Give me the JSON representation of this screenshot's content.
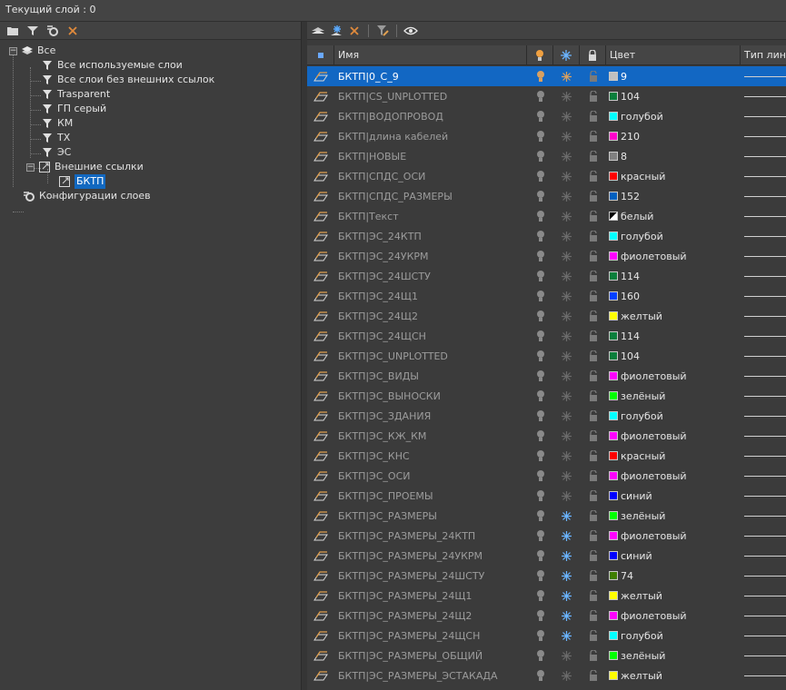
{
  "header": {
    "current_layer": "Текущий слой : 0"
  },
  "filters": {
    "root": "Все",
    "items": [
      "Все используемые слои",
      "Все слои без внешних ссылок",
      "Trasparent",
      "ГП серый",
      "КМ",
      "ТХ",
      "ЭС"
    ],
    "xref_group": "Внешние ссылки",
    "xref_item": "БКТП",
    "config": "Конфигурации слоев"
  },
  "columns": {
    "name": "Имя",
    "color": "Цвет",
    "linetype": "Тип лин"
  },
  "layers": [
    {
      "name": "БКТП|0_С_9",
      "color_name": "9",
      "color": "#c0c0c0",
      "frozen": false,
      "selected": true
    },
    {
      "name": "БКТП|CS_UNPLOTTED",
      "color_name": "104",
      "color": "#0a7f3c",
      "frozen": false
    },
    {
      "name": "БКТП|ВОДОПРОВОД",
      "color_name": "голубой",
      "color": "#00ffff",
      "frozen": false
    },
    {
      "name": "БКТП|длина кабелей",
      "color_name": "210",
      "color": "#ff00cc",
      "frozen": false
    },
    {
      "name": "БКТП|НОВЫЕ",
      "color_name": "8",
      "color": "#808080",
      "frozen": false
    },
    {
      "name": "БКТП|СПДС_ОСИ",
      "color_name": "красный",
      "color": "#ff0000",
      "frozen": false
    },
    {
      "name": "БКТП|СПДС_РАЗМЕРЫ",
      "color_name": "152",
      "color": "#0060c0",
      "frozen": false
    },
    {
      "name": "БКТП|Текст",
      "color_name": "белый",
      "color": "#ffffff",
      "frozen": false,
      "half": true
    },
    {
      "name": "БКТП|ЭС_24КТП",
      "color_name": "голубой",
      "color": "#00ffff",
      "frozen": false
    },
    {
      "name": "БКТП|ЭС_24УКРМ",
      "color_name": "фиолетовый",
      "color": "#ff00ff",
      "frozen": false
    },
    {
      "name": "БКТП|ЭС_24ШСТУ",
      "color_name": "114",
      "color": "#0a7f3c",
      "frozen": false
    },
    {
      "name": "БКТП|ЭС_24Щ1",
      "color_name": "160",
      "color": "#0040ff",
      "frozen": false
    },
    {
      "name": "БКТП|ЭС_24Щ2",
      "color_name": "желтый",
      "color": "#ffff00",
      "frozen": false
    },
    {
      "name": "БКТП|ЭС_24ЩСН",
      "color_name": "114",
      "color": "#0a7f3c",
      "frozen": false
    },
    {
      "name": "БКТП|ЭС_UNPLOTTED",
      "color_name": "104",
      "color": "#0a7f3c",
      "frozen": false
    },
    {
      "name": "БКТП|ЭС_ВИДЫ",
      "color_name": "фиолетовый",
      "color": "#ff00ff",
      "frozen": false
    },
    {
      "name": "БКТП|ЭС_ВЫНОСКИ",
      "color_name": "зелёный",
      "color": "#00ff00",
      "frozen": false
    },
    {
      "name": "БКТП|ЭС_ЗДАНИЯ",
      "color_name": "голубой",
      "color": "#00ffff",
      "frozen": false
    },
    {
      "name": "БКТП|ЭС_КЖ_КМ",
      "color_name": "фиолетовый",
      "color": "#ff00ff",
      "frozen": false
    },
    {
      "name": "БКТП|ЭС_КНС",
      "color_name": "красный",
      "color": "#ff0000",
      "frozen": false
    },
    {
      "name": "БКТП|ЭС_ОСИ",
      "color_name": "фиолетовый",
      "color": "#ff00ff",
      "frozen": false
    },
    {
      "name": "БКТП|ЭС_ПРОЕМЫ",
      "color_name": "синий",
      "color": "#0000ff",
      "frozen": false
    },
    {
      "name": "БКТП|ЭС_РАЗМЕРЫ",
      "color_name": "зелёный",
      "color": "#00ff00",
      "frozen": true
    },
    {
      "name": "БКТП|ЭС_РАЗМЕРЫ_24КТП",
      "color_name": "фиолетовый",
      "color": "#ff00ff",
      "frozen": true
    },
    {
      "name": "БКТП|ЭС_РАЗМЕРЫ_24УКРМ",
      "color_name": "синий",
      "color": "#0000ff",
      "frozen": true
    },
    {
      "name": "БКТП|ЭС_РАЗМЕРЫ_24ШСТУ",
      "color_name": "74",
      "color": "#3f7f00",
      "frozen": true
    },
    {
      "name": "БКТП|ЭС_РАЗМЕРЫ_24Щ1",
      "color_name": "желтый",
      "color": "#ffff00",
      "frozen": true
    },
    {
      "name": "БКТП|ЭС_РАЗМЕРЫ_24Щ2",
      "color_name": "фиолетовый",
      "color": "#ff00ff",
      "frozen": true
    },
    {
      "name": "БКТП|ЭС_РАЗМЕРЫ_24ЩСН",
      "color_name": "голубой",
      "color": "#00ffff",
      "frozen": true
    },
    {
      "name": "БКТП|ЭС_РАЗМЕРЫ_ОБЩИЙ",
      "color_name": "зелёный",
      "color": "#00ff00",
      "frozen": false
    },
    {
      "name": "БКТП|ЭС_РАЗМЕРЫ_ЭСТАКАДА",
      "color_name": "желтый",
      "color": "#ffff00",
      "frozen": false
    }
  ]
}
